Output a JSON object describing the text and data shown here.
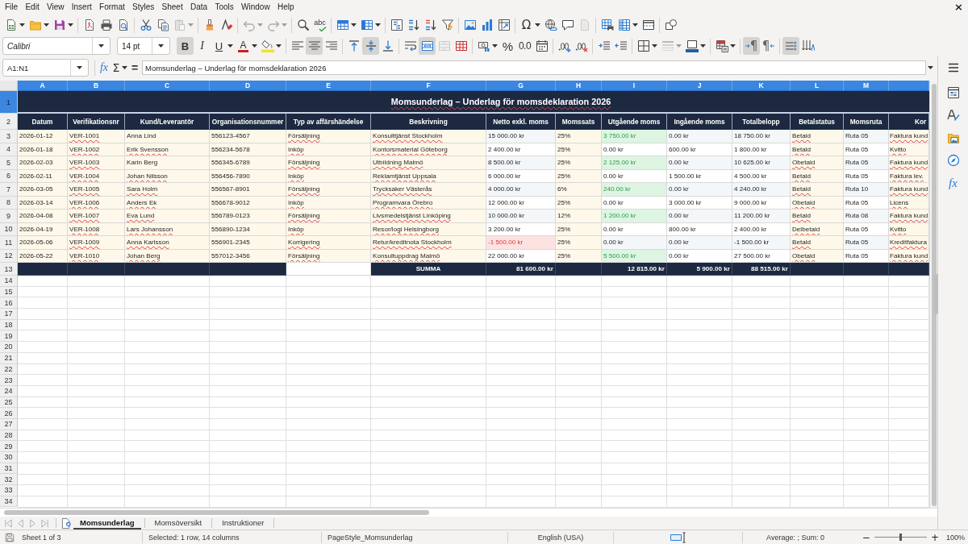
{
  "menu_bar": {
    "items": [
      "File",
      "Edit",
      "View",
      "Insert",
      "Format",
      "Styles",
      "Sheet",
      "Data",
      "Tools",
      "Window",
      "Help"
    ],
    "close_label": "×"
  },
  "standard_toolbar": {
    "paste": {
      "disabled": true
    },
    "undo": {
      "disabled": true
    },
    "redo": {
      "disabled": true
    },
    "spelling_label": "abc",
    "special_character_label": "Ω",
    "header_footer": {
      "disabled": true
    }
  },
  "formatting_toolbar": {
    "font_name": "Calibri",
    "font_size": "14 pt",
    "bold": {
      "label": "B",
      "on": true
    },
    "italic": {
      "label": "I",
      "on": false
    },
    "underline": {
      "label": "U",
      "on": false
    },
    "font_color_label": "A",
    "align_left": {
      "on": false
    },
    "align_center": {
      "on": true
    },
    "align_right": {
      "on": false
    },
    "align_top": {
      "on": false
    },
    "align_middle": {
      "on": true
    },
    "align_bottom": {
      "on": false
    },
    "wrap_text": {
      "on": false
    },
    "merge_and_center": {
      "on": true
    },
    "merge_cells": {
      "disabled": true
    },
    "percent_label": "%",
    "decimal_label": "0.0",
    "border_style": {
      "disabled": true
    },
    "left_to_right": {
      "label": "¶",
      "on": true
    },
    "right_to_left": {
      "label": "¶",
      "on": false
    },
    "text_direction": {
      "on": true
    }
  },
  "formula_bar": {
    "name_box": "A1:N1",
    "function_label": "fx",
    "sum_label": "Σ",
    "equals_label": "=",
    "content": "Momsunderlag – Underlag för momsdeklaration 2026"
  },
  "sheet": {
    "column_headers": [
      {
        "label": "A",
        "selected": true
      },
      {
        "label": "B",
        "selected": true
      },
      {
        "label": "C",
        "selected": true
      },
      {
        "label": "D",
        "selected": true
      },
      {
        "label": "E",
        "selected": true
      },
      {
        "label": "F",
        "selected": true
      },
      {
        "label": "G",
        "selected": true
      },
      {
        "label": "H",
        "selected": true
      },
      {
        "label": "I",
        "selected": true
      },
      {
        "label": "J",
        "selected": true
      },
      {
        "label": "K",
        "selected": true
      },
      {
        "label": "L",
        "selected": true
      },
      {
        "label": "M",
        "selected": true
      }
    ],
    "row_headers": [
      {
        "label": "1",
        "selected": true
      },
      {
        "label": "2",
        "selected": false
      },
      {
        "label": "3",
        "selected": false
      },
      {
        "label": "4",
        "selected": false
      },
      {
        "label": "5",
        "selected": false
      },
      {
        "label": "6",
        "selected": false
      },
      {
        "label": "7",
        "selected": false
      },
      {
        "label": "8",
        "selected": false
      },
      {
        "label": "9",
        "selected": false
      },
      {
        "label": "10",
        "selected": false
      },
      {
        "label": "11",
        "selected": false
      },
      {
        "label": "12",
        "selected": false
      },
      {
        "label": "13",
        "selected": false
      },
      {
        "label": "14",
        "selected": false
      },
      {
        "label": "15",
        "selected": false
      },
      {
        "label": "16",
        "selected": false
      },
      {
        "label": "17",
        "selected": false
      },
      {
        "label": "18",
        "selected": false
      },
      {
        "label": "19",
        "selected": false
      },
      {
        "label": "20",
        "selected": false
      },
      {
        "label": "21",
        "selected": false
      },
      {
        "label": "22",
        "selected": false
      },
      {
        "label": "23",
        "selected": false
      },
      {
        "label": "24",
        "selected": false
      },
      {
        "label": "25",
        "selected": false
      },
      {
        "label": "26",
        "selected": false
      },
      {
        "label": "27",
        "selected": false
      },
      {
        "label": "28",
        "selected": false
      },
      {
        "label": "29",
        "selected": false
      },
      {
        "label": "30",
        "selected": false
      },
      {
        "label": "31",
        "selected": false
      },
      {
        "label": "32",
        "selected": false
      },
      {
        "label": "33",
        "selected": false
      },
      {
        "label": "34",
        "selected": false
      }
    ],
    "title": {
      "text": "Momsunderlag – Underlag för momsdeklaration 2026",
      "misspelled": true
    },
    "columns": [
      "Datum",
      "Verifikationsnr",
      "Kund/Leverantör",
      "Organisationsnummer",
      "Typ av affärshändelse",
      "Beskrivning",
      "Netto exkl. moms",
      "Momssats",
      "Utgående moms",
      "Ingående moms",
      "Totalbelopp",
      "Betalstatus",
      "Momsruta",
      "Kor"
    ],
    "rows": [
      {
        "cells": [
          {
            "text": "2026-01-12",
            "misspelled": false
          },
          {
            "text": "VER-1001",
            "misspelled": true
          },
          {
            "text": "Anna Lind",
            "misspelled": false
          },
          {
            "text": "556123-4567",
            "misspelled": false
          },
          {
            "text": "Försäljning",
            "misspelled": true
          },
          {
            "text": "Konsulttjänst Stockholm",
            "misspelled": true
          },
          {
            "text": "15 000.00 kr",
            "misspelled": false
          },
          {
            "text": "25%",
            "misspelled": false
          },
          {
            "text": "3 750.00 kr",
            "misspelled": false
          },
          {
            "text": "0.00 kr",
            "misspelled": false
          },
          {
            "text": "18 750.00 kr",
            "misspelled": false
          },
          {
            "text": "Betald",
            "misspelled": true
          },
          {
            "text": "Ruta 05",
            "misspelled": false
          },
          {
            "text": "Faktura kund",
            "misspelled": true
          }
        ],
        "net_negative": false,
        "output_vat_highlighted": true
      },
      {
        "cells": [
          {
            "text": "2026-01-18",
            "misspelled": false
          },
          {
            "text": "VER-1002",
            "misspelled": true
          },
          {
            "text": "Erik Svensson",
            "misspelled": true
          },
          {
            "text": "556234-5678",
            "misspelled": false
          },
          {
            "text": "Inköp",
            "misspelled": true
          },
          {
            "text": "Kontorsmaterial Göteborg",
            "misspelled": true
          },
          {
            "text": "2 400.00 kr",
            "misspelled": false
          },
          {
            "text": "25%",
            "misspelled": false
          },
          {
            "text": "0.00 kr",
            "misspelled": false
          },
          {
            "text": "600.00 kr",
            "misspelled": false
          },
          {
            "text": "1 800.00 kr",
            "misspelled": false
          },
          {
            "text": "Betald",
            "misspelled": true
          },
          {
            "text": "Ruta 05",
            "misspelled": false
          },
          {
            "text": "Kvitto",
            "misspelled": true
          }
        ],
        "net_negative": false,
        "output_vat_highlighted": false
      },
      {
        "cells": [
          {
            "text": "2026-02-03",
            "misspelled": false
          },
          {
            "text": "VER-1003",
            "misspelled": true
          },
          {
            "text": "Karin Berg",
            "misspelled": false
          },
          {
            "text": "556345-6789",
            "misspelled": false
          },
          {
            "text": "Försäljning",
            "misspelled": true
          },
          {
            "text": "Utbildning Malmö",
            "misspelled": true
          },
          {
            "text": "8 500.00 kr",
            "misspelled": false
          },
          {
            "text": "25%",
            "misspelled": false
          },
          {
            "text": "2 125.00 kr",
            "misspelled": false
          },
          {
            "text": "0.00 kr",
            "misspelled": false
          },
          {
            "text": "10 625.00 kr",
            "misspelled": false
          },
          {
            "text": "Obetald",
            "misspelled": true
          },
          {
            "text": "Ruta 05",
            "misspelled": false
          },
          {
            "text": "Faktura kund",
            "misspelled": true
          }
        ],
        "net_negative": false,
        "output_vat_highlighted": true
      },
      {
        "cells": [
          {
            "text": "2026-02-11",
            "misspelled": false
          },
          {
            "text": "VER-1004",
            "misspelled": true
          },
          {
            "text": "Johan Nilsson",
            "misspelled": true
          },
          {
            "text": "556456-7890",
            "misspelled": false
          },
          {
            "text": "Inköp",
            "misspelled": true
          },
          {
            "text": "Reklamtjänst Uppsala",
            "misspelled": true
          },
          {
            "text": "6 000.00 kr",
            "misspelled": false
          },
          {
            "text": "25%",
            "misspelled": false
          },
          {
            "text": "0.00 kr",
            "misspelled": false
          },
          {
            "text": "1 500.00 kr",
            "misspelled": false
          },
          {
            "text": "4 500.00 kr",
            "misspelled": false
          },
          {
            "text": "Betald",
            "misspelled": true
          },
          {
            "text": "Ruta 05",
            "misspelled": false
          },
          {
            "text": "Faktura lev.",
            "misspelled": true
          }
        ],
        "net_negative": false,
        "output_vat_highlighted": false
      },
      {
        "cells": [
          {
            "text": "2026-03-05",
            "misspelled": false
          },
          {
            "text": "VER-1005",
            "misspelled": true
          },
          {
            "text": "Sara Holm",
            "misspelled": true
          },
          {
            "text": "556567-8901",
            "misspelled": false
          },
          {
            "text": "Försäljning",
            "misspelled": true
          },
          {
            "text": "Trycksaker Västerås",
            "misspelled": true
          },
          {
            "text": "4 000.00 kr",
            "misspelled": false
          },
          {
            "text": "6%",
            "misspelled": false
          },
          {
            "text": "240.00 kr",
            "misspelled": false
          },
          {
            "text": "0.00 kr",
            "misspelled": false
          },
          {
            "text": "4 240.00 kr",
            "misspelled": false
          },
          {
            "text": "Betald",
            "misspelled": true
          },
          {
            "text": "Ruta 10",
            "misspelled": false
          },
          {
            "text": "Faktura kund",
            "misspelled": true
          }
        ],
        "net_negative": false,
        "output_vat_highlighted": true
      },
      {
        "cells": [
          {
            "text": "2026-03-14",
            "misspelled": false
          },
          {
            "text": "VER-1006",
            "misspelled": true
          },
          {
            "text": "Anders Ek",
            "misspelled": true
          },
          {
            "text": "556678-9012",
            "misspelled": false
          },
          {
            "text": "Inköp",
            "misspelled": true
          },
          {
            "text": "Programvara Örebro",
            "misspelled": true
          },
          {
            "text": "12 000.00 kr",
            "misspelled": false
          },
          {
            "text": "25%",
            "misspelled": false
          },
          {
            "text": "0.00 kr",
            "misspelled": false
          },
          {
            "text": "3 000.00 kr",
            "misspelled": false
          },
          {
            "text": "9 000.00 kr",
            "misspelled": false
          },
          {
            "text": "Obetald",
            "misspelled": true
          },
          {
            "text": "Ruta 05",
            "misspelled": false
          },
          {
            "text": "Licens",
            "misspelled": true
          }
        ],
        "net_negative": false,
        "output_vat_highlighted": false
      },
      {
        "cells": [
          {
            "text": "2026-04-08",
            "misspelled": false
          },
          {
            "text": "VER-1007",
            "misspelled": true
          },
          {
            "text": "Eva Lund",
            "misspelled": true
          },
          {
            "text": "556789-0123",
            "misspelled": false
          },
          {
            "text": "Försäljning",
            "misspelled": true
          },
          {
            "text": "Livsmedelstjänst Linköping",
            "misspelled": true
          },
          {
            "text": "10 000.00 kr",
            "misspelled": false
          },
          {
            "text": "12%",
            "misspelled": false
          },
          {
            "text": "1 200.00 kr",
            "misspelled": false
          },
          {
            "text": "0.00 kr",
            "misspelled": false
          },
          {
            "text": "11 200.00 kr",
            "misspelled": false
          },
          {
            "text": "Betald",
            "misspelled": true
          },
          {
            "text": "Ruta 08",
            "misspelled": false
          },
          {
            "text": "Faktura kund",
            "misspelled": true
          }
        ],
        "net_negative": false,
        "output_vat_highlighted": true
      },
      {
        "cells": [
          {
            "text": "2026-04-19",
            "misspelled": false
          },
          {
            "text": "VER-1008",
            "misspelled": true
          },
          {
            "text": "Lars Johansson",
            "misspelled": true
          },
          {
            "text": "556890-1234",
            "misspelled": false
          },
          {
            "text": "Inköp",
            "misspelled": true
          },
          {
            "text": "Resor/logi Helsingborg",
            "misspelled": true
          },
          {
            "text": "3 200.00 kr",
            "misspelled": false
          },
          {
            "text": "25%",
            "misspelled": false
          },
          {
            "text": "0.00 kr",
            "misspelled": false
          },
          {
            "text": "800.00 kr",
            "misspelled": false
          },
          {
            "text": "2 400.00 kr",
            "misspelled": false
          },
          {
            "text": "Delbetald",
            "misspelled": true
          },
          {
            "text": "Ruta 05",
            "misspelled": false
          },
          {
            "text": "Kvitto",
            "misspelled": true
          }
        ],
        "net_negative": false,
        "output_vat_highlighted": false
      },
      {
        "cells": [
          {
            "text": "2026-05-06",
            "misspelled": false
          },
          {
            "text": "VER-1009",
            "misspelled": true
          },
          {
            "text": "Anna Karlsson",
            "misspelled": true
          },
          {
            "text": "556901-2345",
            "misspelled": false
          },
          {
            "text": "Korrigering",
            "misspelled": true
          },
          {
            "text": "Retur/kreditnota Stockholm",
            "misspelled": true
          },
          {
            "text": "-1 500.00 kr",
            "misspelled": false
          },
          {
            "text": "25%",
            "misspelled": false
          },
          {
            "text": "0.00 kr",
            "misspelled": false
          },
          {
            "text": "0.00 kr",
            "misspelled": false
          },
          {
            "text": "-1 500.00 kr",
            "misspelled": false
          },
          {
            "text": "Betald",
            "misspelled": true
          },
          {
            "text": "Ruta 05",
            "misspelled": false
          },
          {
            "text": "Kreditfaktura",
            "misspelled": true
          }
        ],
        "net_negative": true,
        "output_vat_highlighted": false
      },
      {
        "cells": [
          {
            "text": "2026-05-22",
            "misspelled": false
          },
          {
            "text": "VER-1010",
            "misspelled": true
          },
          {
            "text": "Johan Berg",
            "misspelled": true
          },
          {
            "text": "557012-3456",
            "misspelled": false
          },
          {
            "text": "Försäljning",
            "misspelled": true
          },
          {
            "text": "Konsultuppdrag Malmö",
            "misspelled": true
          },
          {
            "text": "22 000.00 kr",
            "misspelled": false
          },
          {
            "text": "25%",
            "misspelled": false
          },
          {
            "text": "5 500.00 kr",
            "misspelled": false
          },
          {
            "text": "0.00 kr",
            "misspelled": false
          },
          {
            "text": "27 500.00 kr",
            "misspelled": false
          },
          {
            "text": "Obetald",
            "misspelled": true
          },
          {
            "text": "Ruta 05",
            "misspelled": false
          },
          {
            "text": "Faktura kund",
            "misspelled": true
          }
        ],
        "net_negative": false,
        "output_vat_highlighted": true
      }
    ],
    "totals": {
      "label": "SUMMA",
      "net": "81 600.00 kr",
      "output_vat": "12 815.00 kr",
      "input_vat": "5 900.00 kr",
      "total": "88 515.00 kr"
    }
  },
  "sheet_navigation": {
    "disabled": true
  },
  "sheet_tabs": [
    {
      "label": "Momsunderlag",
      "selected": true
    },
    {
      "label": "Momsöversikt",
      "selected": false
    },
    {
      "label": "Instruktioner",
      "selected": false
    }
  ],
  "sidebar": {
    "functions_label": "fx"
  },
  "status_bar": {
    "sheet": "Sheet 1 of 3",
    "selection": "Selected: 1 row, 14 columns",
    "page_style": "PageStyle_Momsunderlag",
    "language": "English (USA)",
    "summary": "Average: ; Sum: 0",
    "zoom": {
      "minus": "−",
      "plus": "+",
      "level": 0.5,
      "label": "100%"
    }
  }
}
